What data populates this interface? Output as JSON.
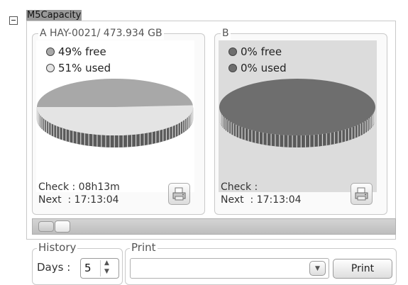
{
  "tree": {
    "title": "M5Capacity"
  },
  "disks": [
    {
      "title": "A HAY-0021/   473.934 GB",
      "free_label": "49% free",
      "used_label": "51% used",
      "free_pct": 49,
      "used_pct": 51,
      "check_text": "Check : 08h13m",
      "next_text": "Next  : 17:13:04",
      "free_color": "#a8a8a8",
      "used_color": "#e4e4e4",
      "bg_color": "#ffffff"
    },
    {
      "title": "B",
      "free_label": "0% free",
      "used_label": "0% used",
      "free_pct": 0,
      "used_pct": 0,
      "check_text": "Check :",
      "next_text": "Next  : 17:13:04",
      "free_color": "#6e6e6e",
      "used_color": "#6e6e6e",
      "bg_color": "#dcdcdc"
    }
  ],
  "history": {
    "group_label": "History",
    "days_label": "Days :",
    "days_value": "5"
  },
  "print": {
    "group_label": "Print",
    "selected": "",
    "button_label": "Print"
  },
  "icons": {
    "printer": "printer-icon",
    "combo": "chevron-down-icon",
    "spin_up": "chevron-up-icon",
    "spin_down": "chevron-down-icon",
    "collapse": "minus-icon"
  }
}
